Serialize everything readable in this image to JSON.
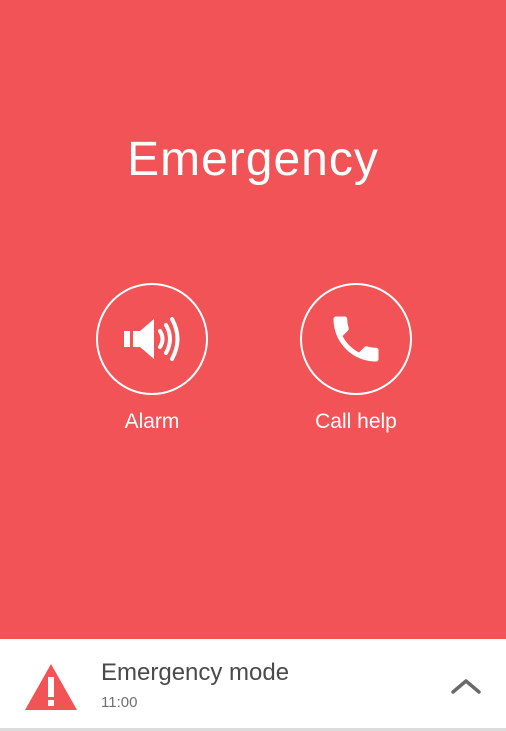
{
  "screen": {
    "title": "Emergency",
    "background_color": "#f15356"
  },
  "actions": [
    {
      "label": "Alarm",
      "icon": "speaker-volume-icon"
    },
    {
      "label": "Call help",
      "icon": "phone-icon"
    }
  ],
  "notification": {
    "title": "Emergency mode",
    "time": "11:00",
    "icon": "warning-icon",
    "expand_icon": "chevron-up-icon",
    "icon_color": "#f15356"
  }
}
